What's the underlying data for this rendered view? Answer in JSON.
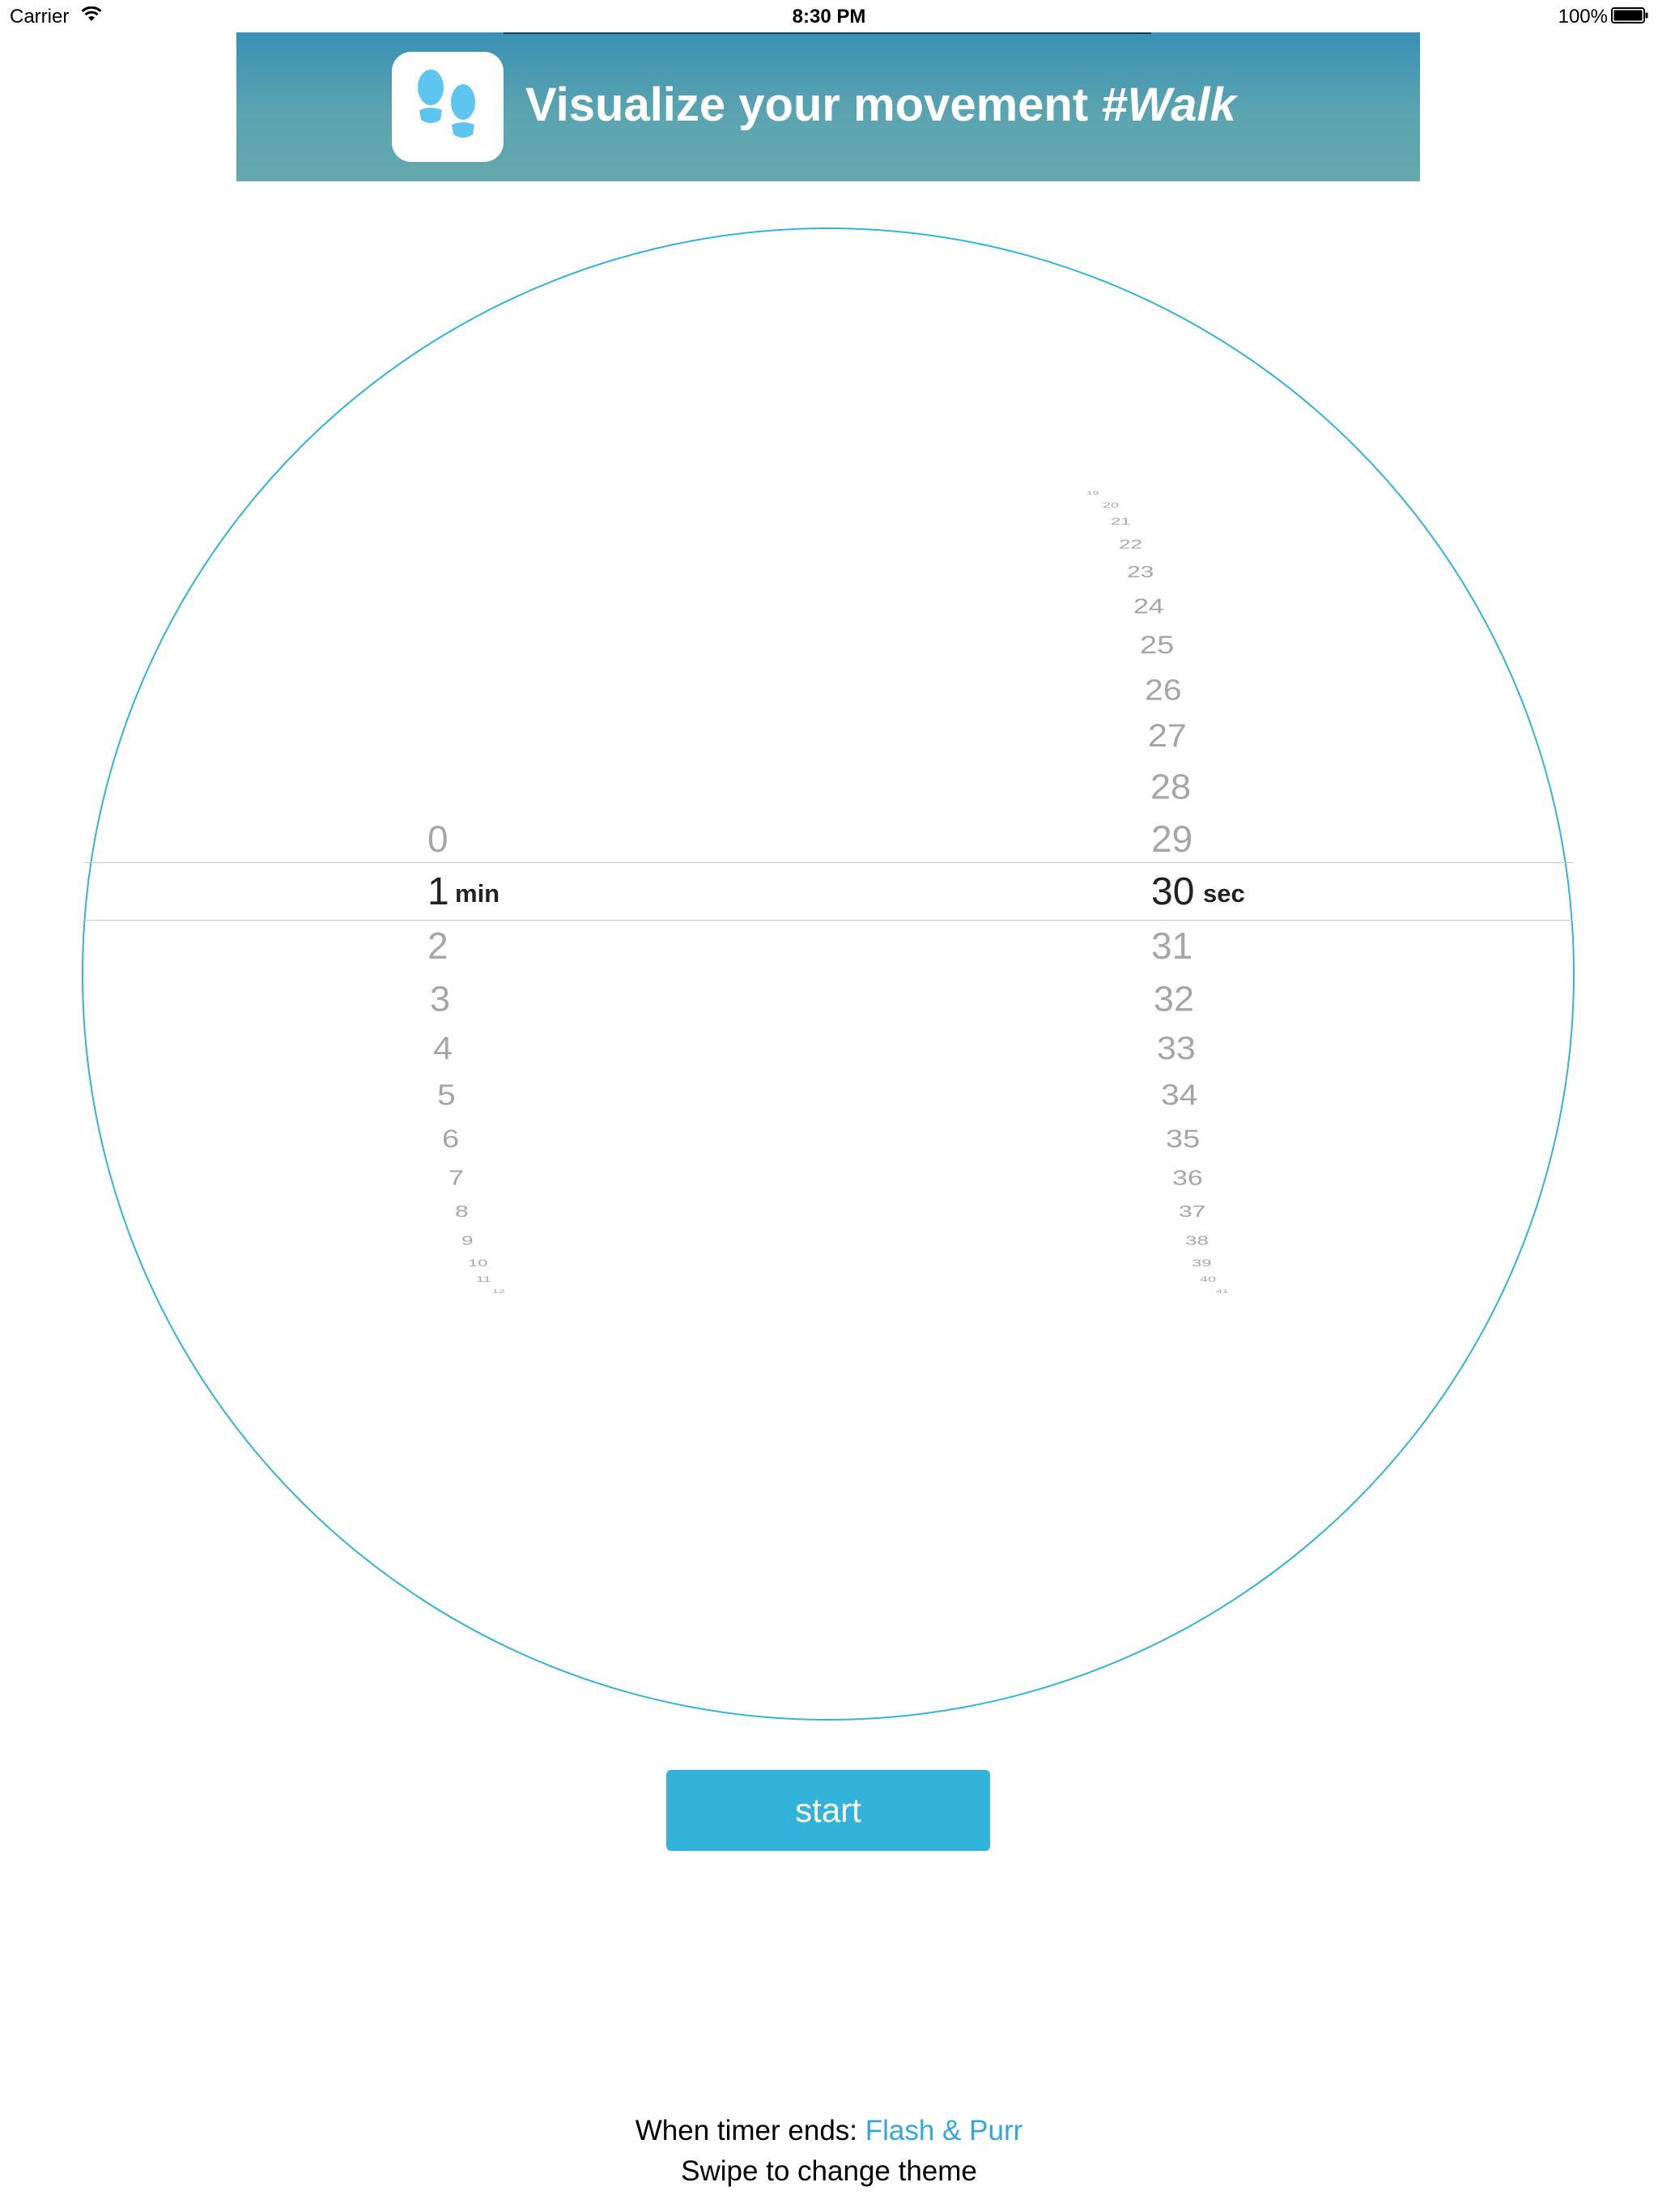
{
  "status_bar": {
    "carrier": "Carrier",
    "time": "8:30 PM",
    "battery": "100%"
  },
  "banner": {
    "title_prefix": "Visualize your movement ",
    "title_hashtag": "#Walk",
    "icon": "footprints-icon"
  },
  "picker": {
    "minutes_values": [
      "0",
      "1",
      "2",
      "3",
      "4",
      "5",
      "6",
      "7",
      "8",
      "9",
      "10",
      "11",
      "12"
    ],
    "minutes_selected": "1",
    "minutes_unit": "min",
    "seconds_values": [
      "19",
      "20",
      "21",
      "22",
      "23",
      "24",
      "25",
      "26",
      "27",
      "28",
      "29",
      "30",
      "31",
      "32",
      "33",
      "34",
      "35",
      "36",
      "37",
      "38",
      "39",
      "40",
      "41"
    ],
    "seconds_selected": "30",
    "seconds_unit": "sec"
  },
  "start_button": {
    "label": "start"
  },
  "footer": {
    "timer_label": "When timer ends:",
    "timer_value": "Flash & Purr",
    "hint": "Swipe to change theme"
  },
  "colors": {
    "accent": "#33b2da",
    "circle": "#33b2da",
    "banner_start": "#3a90b5",
    "banner_end": "#66a8ac"
  }
}
